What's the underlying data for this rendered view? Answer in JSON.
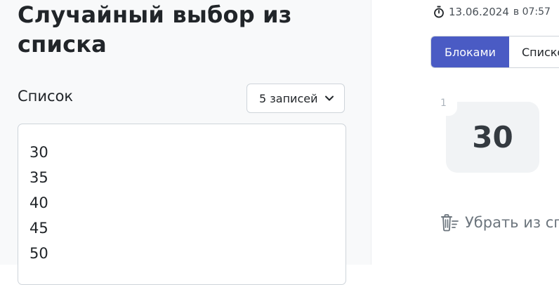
{
  "left": {
    "title": "Случайный выбор из списка",
    "list_label": "Список",
    "count_select": {
      "value": "5 записей"
    },
    "items": [
      "30",
      "35",
      "40",
      "45",
      "50"
    ]
  },
  "right": {
    "timestamp": {
      "date": "13.06.2024",
      "rest": "в 07:57"
    },
    "tabs": [
      {
        "label": "Блоками",
        "active": true
      },
      {
        "label": "Списком",
        "active": false
      }
    ],
    "result": {
      "index": "1",
      "value": "30"
    },
    "remove_label": "Убрать из списка"
  },
  "colors": {
    "accent": "#4a5bc4",
    "card_bg": "#f1f3f5",
    "panel_bg": "#f8f9fa"
  },
  "icons": [
    "stopwatch-icon",
    "chevron-down-icon",
    "trash-list-icon"
  ]
}
